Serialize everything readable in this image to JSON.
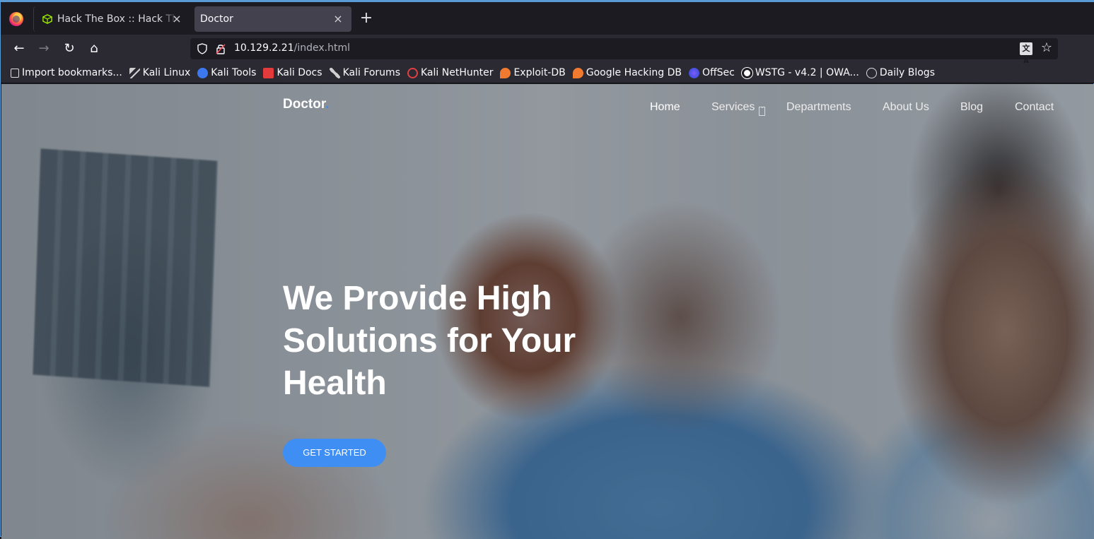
{
  "tabs": [
    {
      "title": "Hack The Box :: Hack The Box",
      "active": false
    },
    {
      "title": "Doctor",
      "active": true
    }
  ],
  "icons": {
    "browser_logo": "firefox-logo",
    "inactive_tab": "hack-the-box-cube-icon",
    "close": "×",
    "new_tab": "+",
    "back": "←",
    "forward": "→",
    "reload": "↻",
    "home": "⌂",
    "bookmark_star": "☆"
  },
  "urlbar": {
    "host": "10.129.2.21",
    "path": "/index.html"
  },
  "bookmarks": [
    {
      "label": "Import bookmarks...",
      "icon": "import-icon",
      "color": "#dddddd"
    },
    {
      "label": "Kali Linux",
      "icon": "kali-dragon-icon",
      "color": "#cfcfcf"
    },
    {
      "label": "Kali Tools",
      "icon": "kali-tools-icon",
      "color": "#3c79f0"
    },
    {
      "label": "Kali Docs",
      "icon": "kali-docs-icon",
      "color": "#e33b3b"
    },
    {
      "label": "Kali Forums",
      "icon": "kali-forums-icon",
      "color": "#cfcfcf"
    },
    {
      "label": "Kali NetHunter",
      "icon": "nethunter-icon",
      "color": "#e04040"
    },
    {
      "label": "Exploit-DB",
      "icon": "exploit-db-icon",
      "color": "#f07a2f"
    },
    {
      "label": "Google Hacking DB",
      "icon": "ghdb-icon",
      "color": "#f07a2f"
    },
    {
      "label": "OffSec",
      "icon": "offsec-icon",
      "color": "#4b6ef5"
    },
    {
      "label": "WSTG - v4.2 | OWA...",
      "icon": "owasp-icon",
      "color": "#ffffff"
    },
    {
      "label": "Daily Blogs",
      "icon": "globe-icon",
      "color": "#dddddd"
    }
  ],
  "site": {
    "logo": "Doctor",
    "logo_dot": ".",
    "nav": [
      "Home",
      "Services",
      "Departments",
      "About Us",
      "Blog",
      "Contact"
    ],
    "hero_title": "We Provide High Solutions for Your Health",
    "cta": "GET STARTED",
    "accent_color": "#3f8ef3"
  }
}
